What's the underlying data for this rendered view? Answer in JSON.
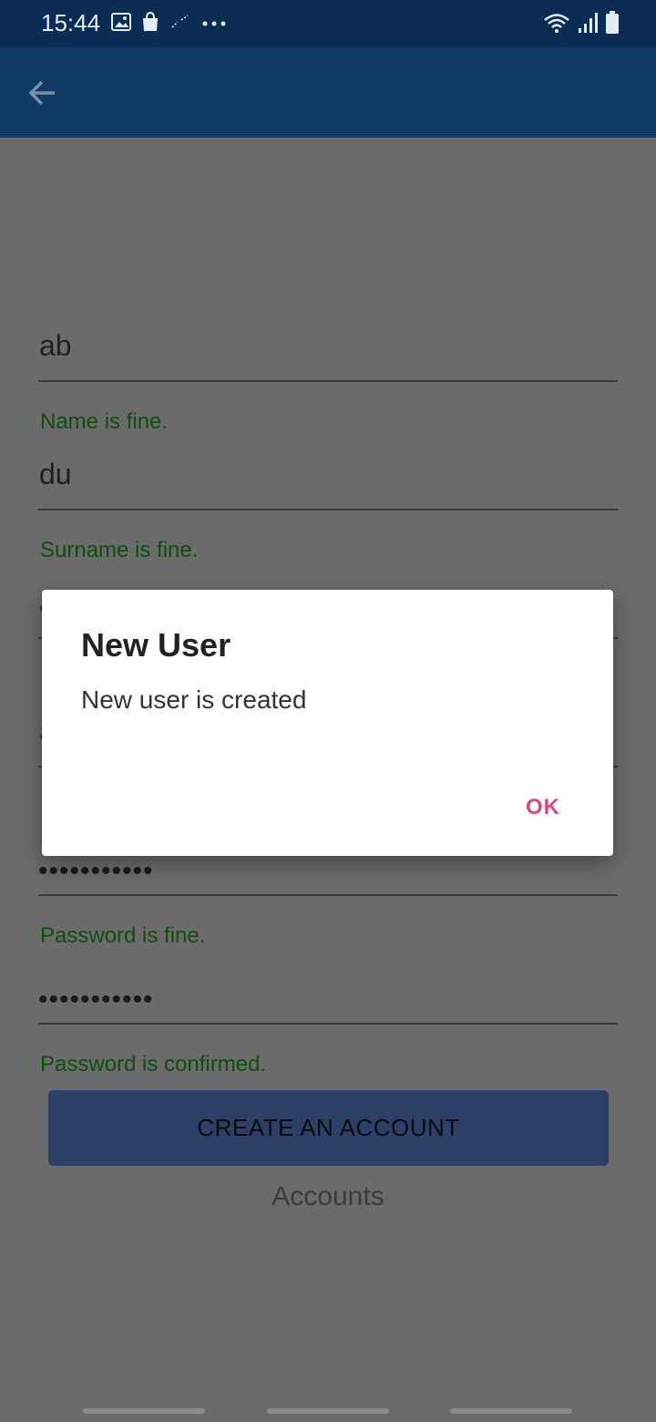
{
  "status_bar": {
    "time": "15:44",
    "icons": [
      "image-icon",
      "shopping-bag-icon",
      "link-icon",
      "more-dots-icon",
      "wifi-icon",
      "signal-icon",
      "battery-icon"
    ]
  },
  "app_bar": {
    "back_icon": "back-arrow-icon"
  },
  "form": {
    "name_value": "ab",
    "name_validation": "Name is fine.",
    "surname_value": "du",
    "surname_validation": "Surname is fine.",
    "field3_value": "a",
    "field4_value": "a",
    "password_value": "•••••••••••",
    "password_validation": "Password is fine.",
    "confirm_password_value": "•••••••••••",
    "confirm_validation": "Password is confirmed."
  },
  "create_button_label": "CREATE AN ACCOUNT",
  "accounts_link_label": "Accounts",
  "dialog": {
    "title": "New User",
    "message": "New user is created",
    "ok_label": "OK"
  },
  "colors": {
    "status_bar": "#0b2c55",
    "app_bar": "#0f3b63",
    "dim_background": "#6b6b6b",
    "validation_text": "#0e4f0e",
    "button_bg": "#2c3f66",
    "dialog_ok": "#e0457e"
  }
}
